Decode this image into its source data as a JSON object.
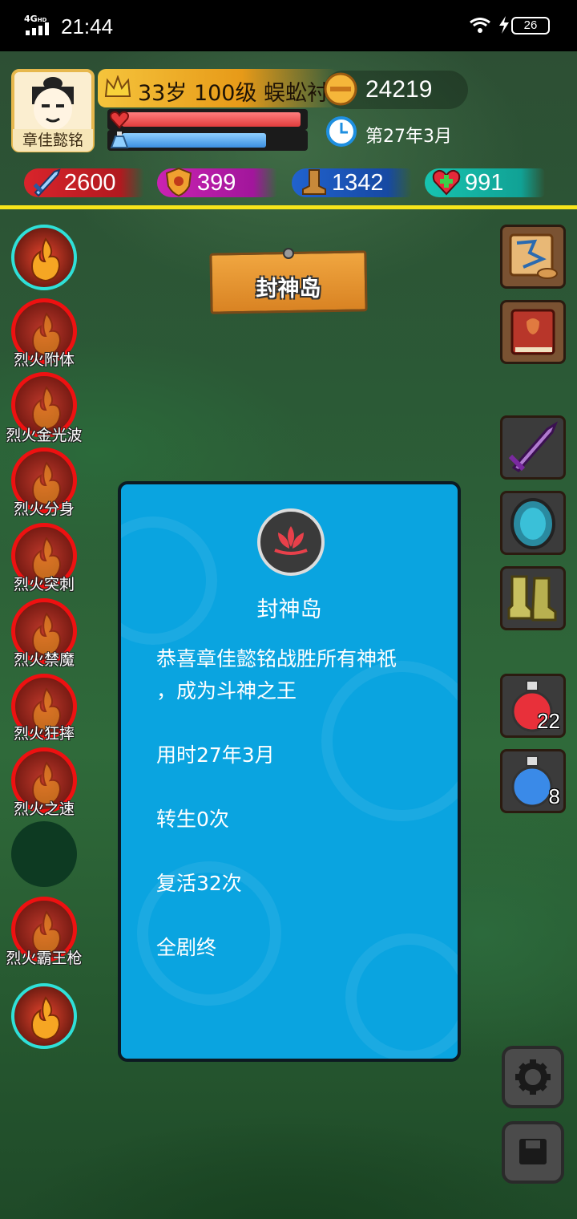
{
  "status_bar": {
    "network": "4G",
    "network_sup": "HD",
    "time": "21:44",
    "battery": "26"
  },
  "player": {
    "name": "章佳懿铭",
    "title_line": "33岁 100级 蜈蚣衬",
    "hp_fraction": 0.98,
    "mp_fraction": 0.79,
    "coins": "24219",
    "date": "第27年3月"
  },
  "stats": {
    "attack": "2600",
    "defense": "399",
    "speed": "1342",
    "health": "991"
  },
  "location_sign": "封神岛",
  "skills": [
    {
      "label": "",
      "icon": "fire-dragon-icon"
    },
    {
      "label": "烈火附体",
      "icon": "fire-icon"
    },
    {
      "label": "烈火金光波",
      "icon": "fire-icon"
    },
    {
      "label": "烈火分身",
      "icon": "fire-icon"
    },
    {
      "label": "烈火突刺",
      "icon": "fire-icon"
    },
    {
      "label": "烈火禁魔",
      "icon": "fire-icon"
    },
    {
      "label": "烈火狂摔",
      "icon": "fire-icon"
    },
    {
      "label": "烈火之速",
      "icon": "fire-icon"
    },
    {
      "label": "",
      "icon": "empty-slot"
    },
    {
      "label": "烈火霸王枪",
      "icon": "fire-icon"
    },
    {
      "label": "",
      "icon": "fire-torch-icon"
    }
  ],
  "right_menu": {
    "map_icon": "scroll-map-icon",
    "book_icon": "book-icon",
    "weapon_icon": "sword-icon",
    "armor_icon": "armor-icon",
    "boots_icon": "boots-icon",
    "hp_potion_count": "22",
    "mp_potion_count": "8",
    "settings_icon": "gear-icon",
    "save_icon": "save-icon"
  },
  "dialog": {
    "title": "封神岛",
    "message_line1": "恭喜章佳懿铭战胜所有神祇",
    "message_line2": "，成为斗神之王",
    "time_used": "用时27年3月",
    "rebirths": "转生0次",
    "revivals": "复活32次",
    "ending": "全剧终"
  },
  "colors": {
    "dialog_bg": "#0aa4e0",
    "hp_bar": "#e03c3c",
    "mp_bar": "#3c8fe0",
    "divider": "#f7e51a"
  }
}
